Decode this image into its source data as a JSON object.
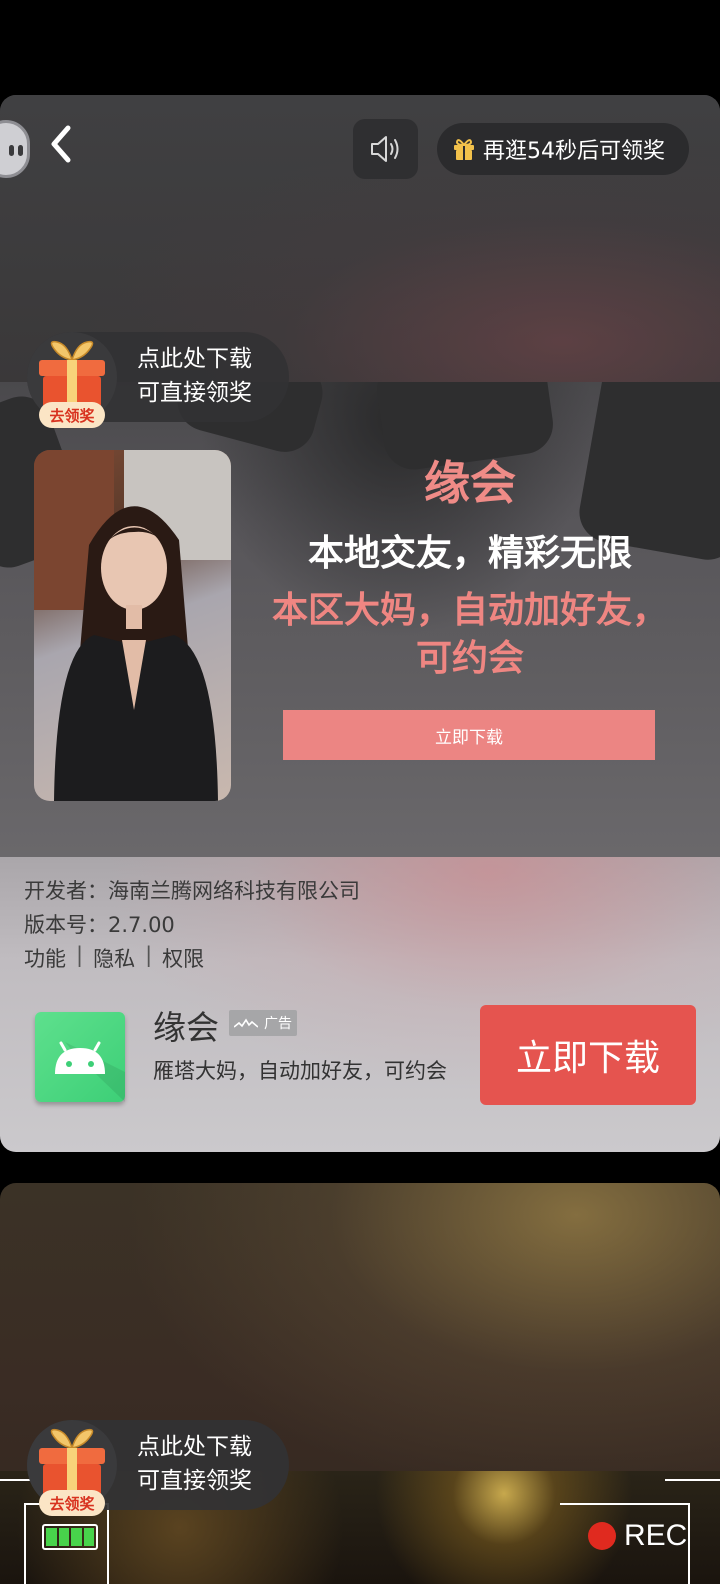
{
  "header": {
    "reward_countdown": "再逛54秒后可领奖"
  },
  "gift_badge": {
    "line1": "点此处下载",
    "line2": "可直接领奖",
    "label": "去领奖"
  },
  "ad": {
    "title": "缘会",
    "subtitle": "本地交友，精彩无限",
    "desc_line1": "本区大妈，自动加好友，",
    "desc_line2": "可约会",
    "download_label": "立即下载"
  },
  "info": {
    "developer": "开发者：海南兰腾网络科技有限公司",
    "version": "版本号：2.7.00",
    "links": [
      "功能",
      "隐私",
      "权限"
    ],
    "link_sep": "|"
  },
  "app": {
    "name": "缘会",
    "ad_tag": "广告",
    "description": "雁塔大妈，自动加好友，可约会",
    "download_label": "立即下载"
  },
  "recording": {
    "label": "REC"
  },
  "colors": {
    "accent": "#e5544f",
    "ad_pink": "#ef8b87",
    "rec_red": "#e02a1f"
  }
}
